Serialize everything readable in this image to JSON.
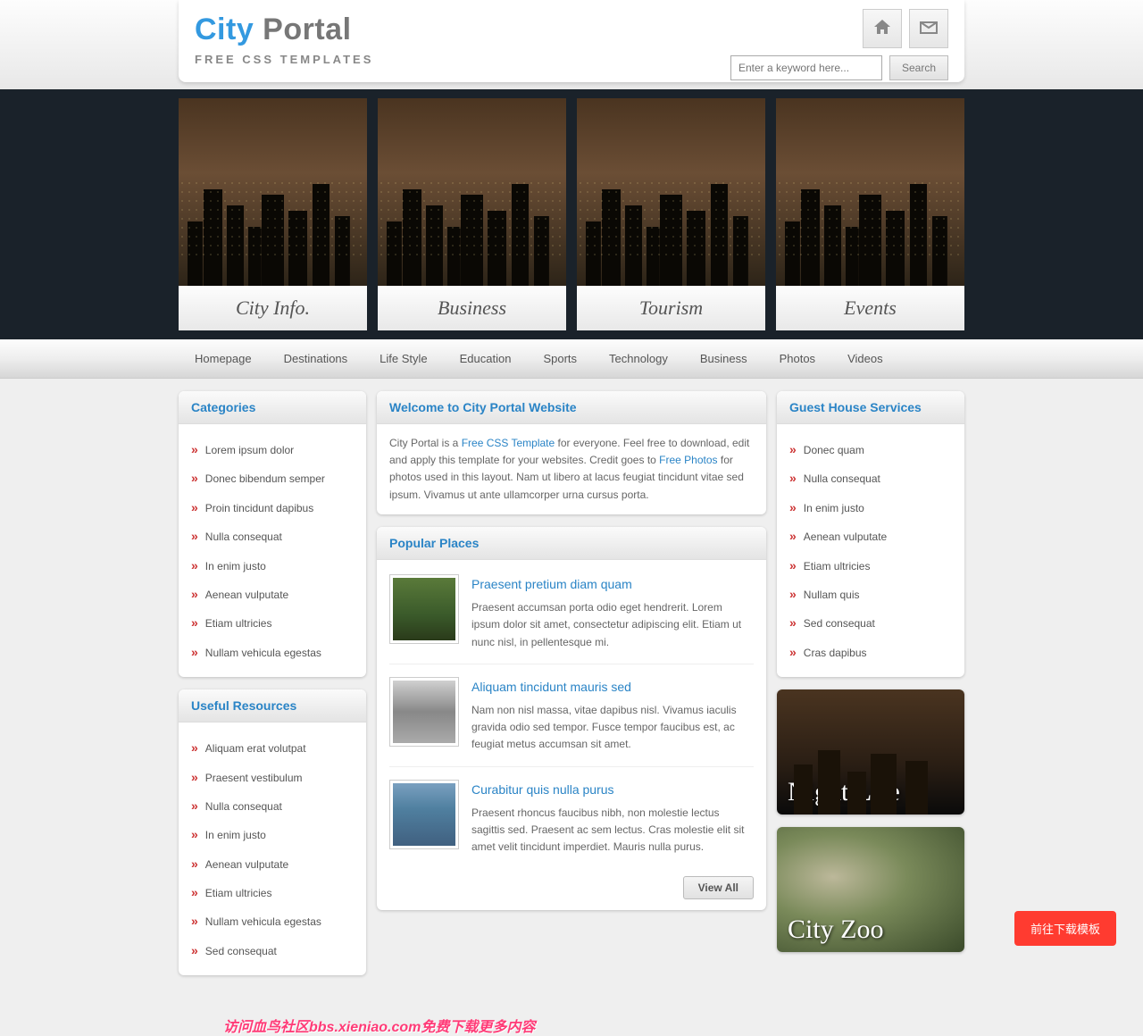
{
  "header": {
    "title_part1": "City",
    "title_part2": " Portal",
    "subtitle": "FREE CSS TEMPLATES",
    "search_placeholder": "Enter a keyword here...",
    "search_button": "Search"
  },
  "hero": [
    {
      "label": "City Info."
    },
    {
      "label": "Business"
    },
    {
      "label": "Tourism"
    },
    {
      "label": "Events"
    }
  ],
  "nav": [
    "Homepage",
    "Destinations",
    "Life Style",
    "Education",
    "Sports",
    "Technology",
    "Business",
    "Photos",
    "Videos"
  ],
  "sidebar_left": [
    {
      "title": "Categories",
      "items": [
        "Lorem ipsum dolor",
        "Donec bibendum semper",
        "Proin tincidunt dapibus",
        "Nulla consequat",
        "In enim justo",
        "Aenean vulputate",
        "Etiam ultricies",
        "Nullam vehicula egestas"
      ]
    },
    {
      "title": "Useful Resources",
      "items": [
        "Aliquam erat volutpat",
        "Praesent vestibulum",
        "Nulla consequat",
        "In enim justo",
        "Aenean vulputate",
        "Etiam ultricies",
        "Nullam vehicula egestas",
        "Sed consequat"
      ]
    }
  ],
  "main": {
    "welcome": {
      "title": "Welcome to City Portal Website",
      "text_pre": "City Portal is a ",
      "link1": "Free CSS Template",
      "text_mid": " for everyone. Feel free to download, edit and apply this template for your websites. Credit goes to ",
      "link2": "Free Photos",
      "text_post": " for photos used in this layout. Nam ut libero at lacus feugiat tincidunt vitae sed ipsum. Vivamus ut ante ullamcorper urna cursus porta."
    },
    "popular": {
      "title": "Popular Places",
      "items": [
        {
          "title": "Praesent pretium diam quam",
          "text": "Praesent accumsan porta odio eget hendrerit. Lorem ipsum dolor sit amet, consectetur adipiscing elit. Etiam ut nunc nisl, in pellentesque mi."
        },
        {
          "title": "Aliquam tincidunt mauris sed",
          "text": "Nam non nisl massa, vitae dapibus nisl. Vivamus iaculis gravida odio sed tempor. Fusce tempor faucibus est, ac feugiat metus accumsan sit amet."
        },
        {
          "title": "Curabitur quis nulla purus",
          "text": "Praesent rhoncus faucibus nibh, non molestie lectus sagittis sed. Praesent ac sem lectus. Cras molestie elit sit amet velit tincidunt imperdiet. Mauris nulla purus."
        }
      ],
      "view_all": "View All"
    }
  },
  "sidebar_right": {
    "title": "Guest House Services",
    "items": [
      "Donec quam",
      "Nulla consequat",
      "In enim justo",
      "Aenean vulputate",
      "Etiam ultricies",
      "Nullam quis",
      "Sed consequat",
      "Cras dapibus"
    ],
    "promos": [
      {
        "label": "Night Life"
      },
      {
        "label": "City Zoo"
      }
    ]
  },
  "float_button": "前往下载模板",
  "watermark": "访问血鸟社区bbs.xieniao.com免费下载更多内容"
}
